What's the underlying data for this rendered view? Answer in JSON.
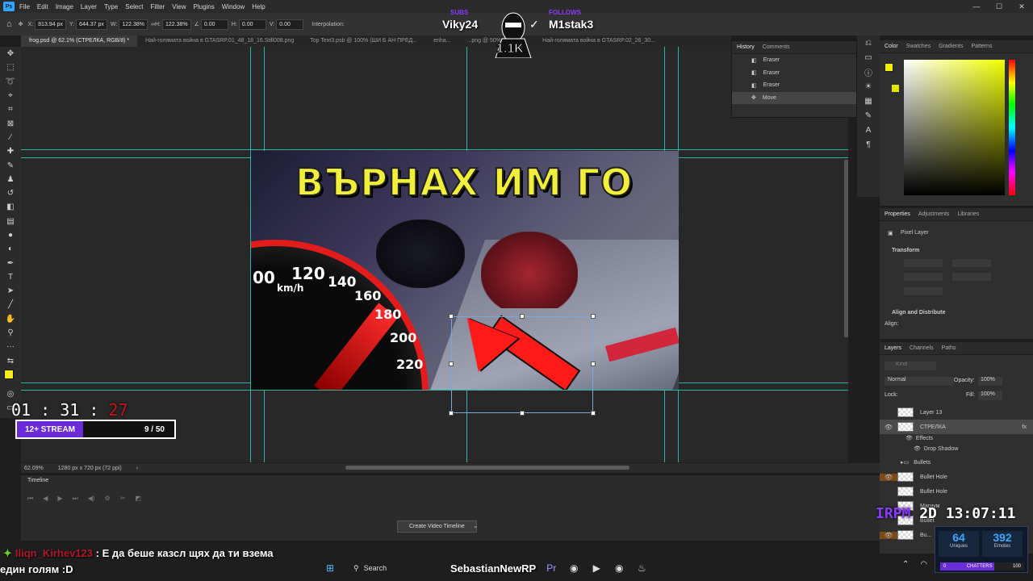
{
  "menubar": {
    "app_icon": "photoshop-logo",
    "items": [
      "File",
      "Edit",
      "Image",
      "Layer",
      "Type",
      "Select",
      "Filter",
      "View",
      "Plugins",
      "Window",
      "Help"
    ]
  },
  "options": {
    "x": "813.94 px",
    "y": "644.37 px",
    "w": "122.38%",
    "h": "122.38%",
    "angle": "0.00",
    "hskew": "0.00",
    "vskew": "0.00",
    "interpolation_label": "Interpolation:",
    "x_label": "X:",
    "y_label": "Y:",
    "w_label": "W:",
    "h_label": "H:"
  },
  "tabs": [
    {
      "label": "frog.psd @ 62.1% (СТРЕЛКА, RGB/8) *",
      "active": true
    },
    {
      "label": "Най-голямата война в GTASRP.01_48_18_16.Still008.png"
    },
    {
      "label": "Top Text3.psb @ 100% (ШИ Б АН ПРЕД..."
    },
    {
      "label": "enha..."
    },
    {
      "label": "...png @ 50% (RGB/8..."
    },
    {
      "label": "Най-голямата война в GTASRP.02_26_30..."
    }
  ],
  "thumbnail": {
    "title": "ВЪРНАХ ИМ ГО",
    "speedometer_labels": [
      "00",
      "120",
      "km/h",
      "140",
      "160",
      "180",
      "200",
      "220"
    ]
  },
  "status": {
    "zoom": "62.09%",
    "doc_size": "1280 px x 720 px (72 ppi)"
  },
  "timeline": {
    "title": "Timeline",
    "create_button": "Create Video Timeline"
  },
  "history": {
    "tabs": [
      "History",
      "Comments"
    ],
    "items": [
      "Eraser",
      "Eraser",
      "Eraser",
      "Move"
    ]
  },
  "color_panel": {
    "tabs": [
      "Color",
      "Swatches",
      "Gradients",
      "Patterns"
    ],
    "foreground": "#f2f200"
  },
  "properties": {
    "tabs": [
      "Properties",
      "Adjustments",
      "Libraries"
    ],
    "layer_type": "Pixel Layer",
    "transform_label": "Transform",
    "align_label": "Align and Distribute",
    "align_sub": "Align:"
  },
  "layers": {
    "tabs": [
      "Layers",
      "Channels",
      "Paths"
    ],
    "blend_mode": "Normal",
    "opacity_label": "Opacity:",
    "opacity": "100%",
    "fill_label": "Fill:",
    "fill": "100%",
    "lock_label": "Lock:",
    "search_placeholder": "Kind",
    "rows": [
      "Layer 13",
      "СТРЕЛКА",
      "Effects",
      "Drop Shadow",
      "Bullets",
      "Bullet Hole",
      "Bullet Hole",
      "Магнум",
      "Bullet",
      "Bu..."
    ]
  },
  "overlay": {
    "timer_main": "01 : 31 : ",
    "timer_red": "27",
    "stream_tag": "12+ STREAM",
    "stream_count": "9 / 50",
    "chat_user": "Iliqn_Kirhev123",
    "chat_line1": ": Е да беше казсл щях да ти взема",
    "chat_line2": "един голям :D",
    "clock_prefix": "IRPM",
    "clock_day": "2D",
    "clock_time": "13:07:11",
    "uniques_value": "64",
    "uniques_label": "Uniques",
    "emotes_value": "392",
    "emotes_label": "Emotes",
    "chatters_label": "CHATTERS",
    "chatters_min": "0",
    "chatters_max": "100",
    "chatters_fraction": 0.64,
    "viewer_left": "Viky24",
    "viewer_right": "M1stak3",
    "viewer_count": "1.1K",
    "tag_left": "SUBS",
    "tag_right": "FOLLOWS",
    "stream_title_overlay": "SebastianNewRP"
  },
  "taskbar": {
    "search_label": "Search"
  },
  "colors": {
    "accent": "#31a8ff",
    "guide": "#2ed4c6",
    "purple": "#6b2bd8",
    "red": "#c6121c"
  }
}
